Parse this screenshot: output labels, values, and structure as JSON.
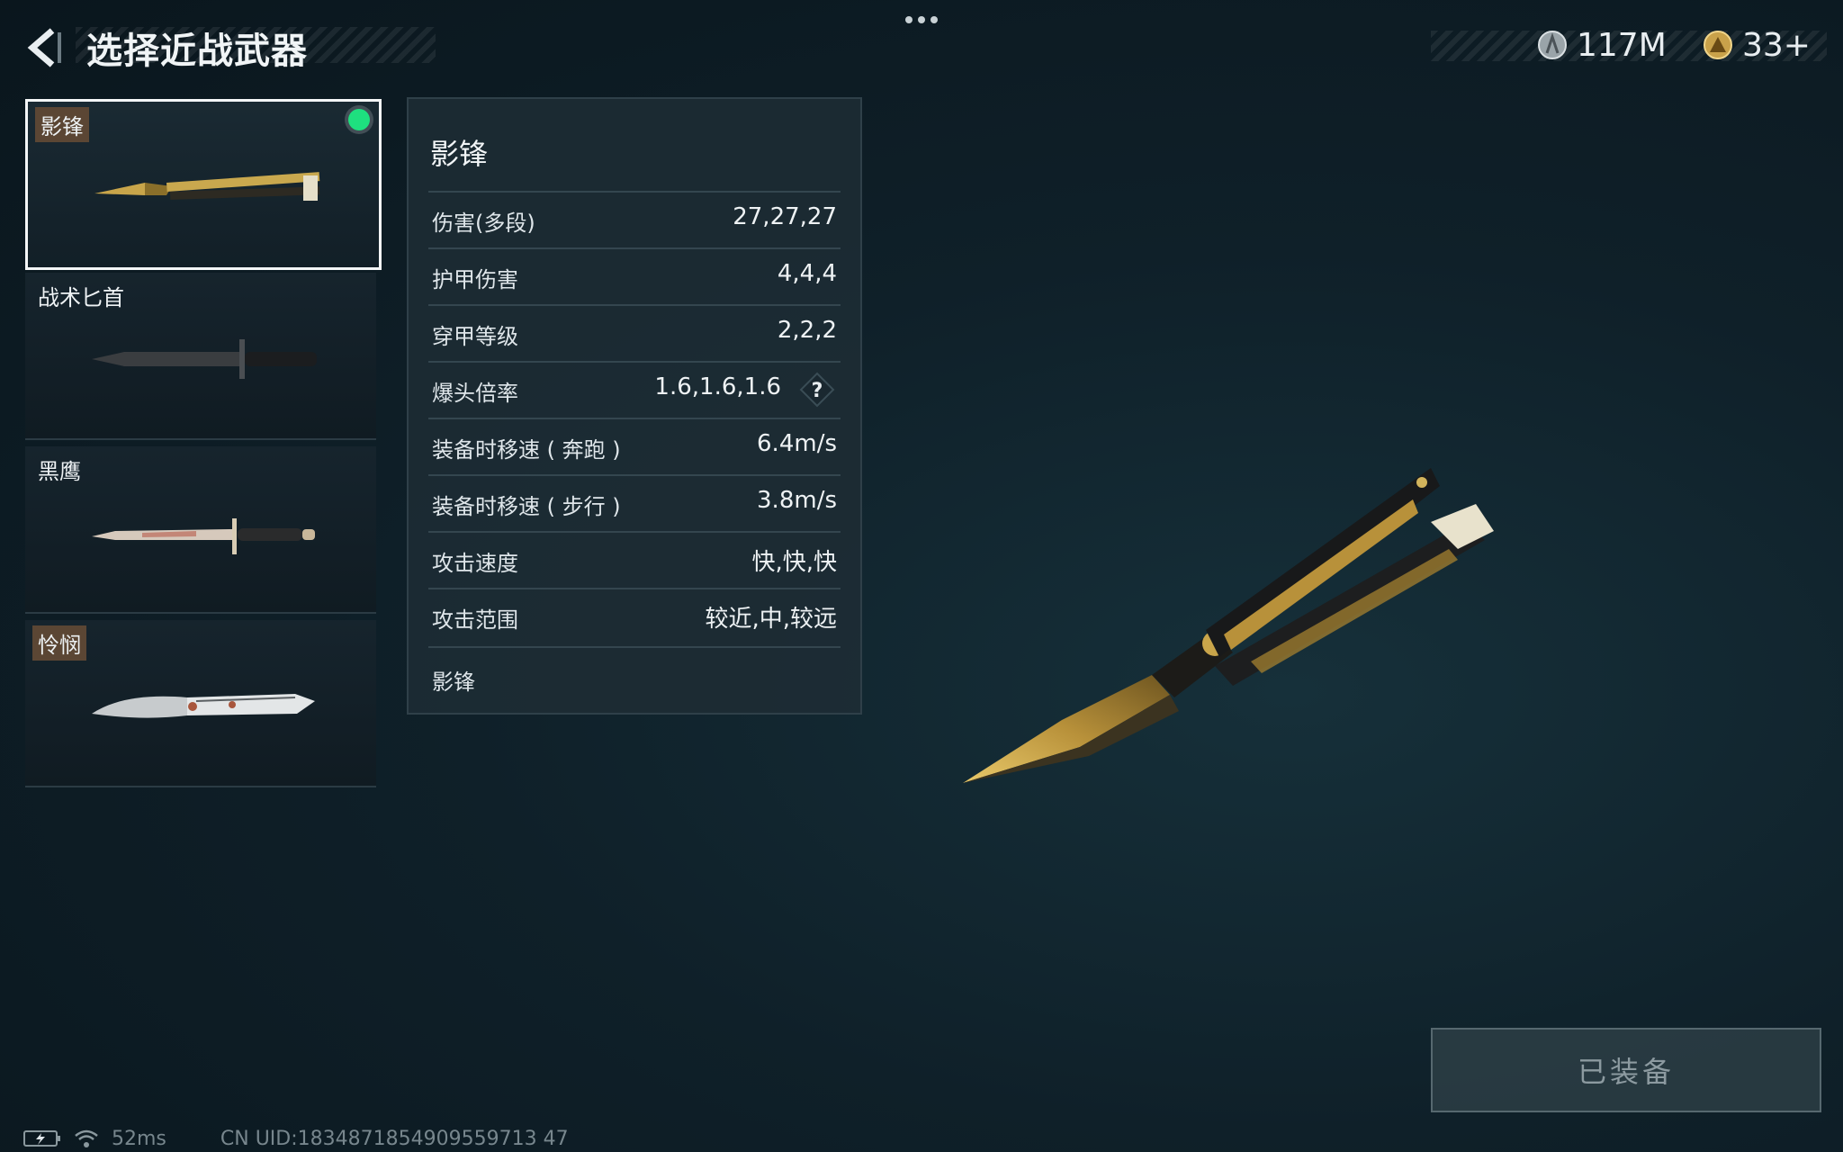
{
  "header": {
    "title": "选择近战武器",
    "currency_silver": "117M",
    "currency_gold": "33+"
  },
  "weapons": [
    {
      "name": "影锋",
      "selected": true,
      "equipped": true
    },
    {
      "name": "战术匕首",
      "selected": false
    },
    {
      "name": "黑鹰",
      "selected": false
    },
    {
      "name": "怜悯",
      "selected": false
    }
  ],
  "stats": {
    "title": "影锋",
    "rows": [
      {
        "label": "伤害(多段)",
        "value": "27,27,27"
      },
      {
        "label": "护甲伤害",
        "value": "4,4,4"
      },
      {
        "label": "穿甲等级",
        "value": "2,2,2"
      },
      {
        "label": "爆头倍率",
        "value": "1.6,1.6,1.6"
      },
      {
        "label": "装备时移速 ( 奔跑 )",
        "value": "6.4m/s"
      },
      {
        "label": "装备时移速 ( 步行 )",
        "value": "3.8m/s"
      },
      {
        "label": "攻击速度",
        "value": "快,快,快"
      },
      {
        "label": "攻击范围",
        "value": "较近,中,较远"
      }
    ],
    "footer": "影锋",
    "help_symbol": "?"
  },
  "equip_button": {
    "label": "已装备"
  },
  "status_bar": {
    "ping": "52ms",
    "uid": "CN UID:1834871854909559713 47"
  },
  "colors": {
    "accent_green": "#1ee07f",
    "tag_brown": "#5b4634"
  }
}
